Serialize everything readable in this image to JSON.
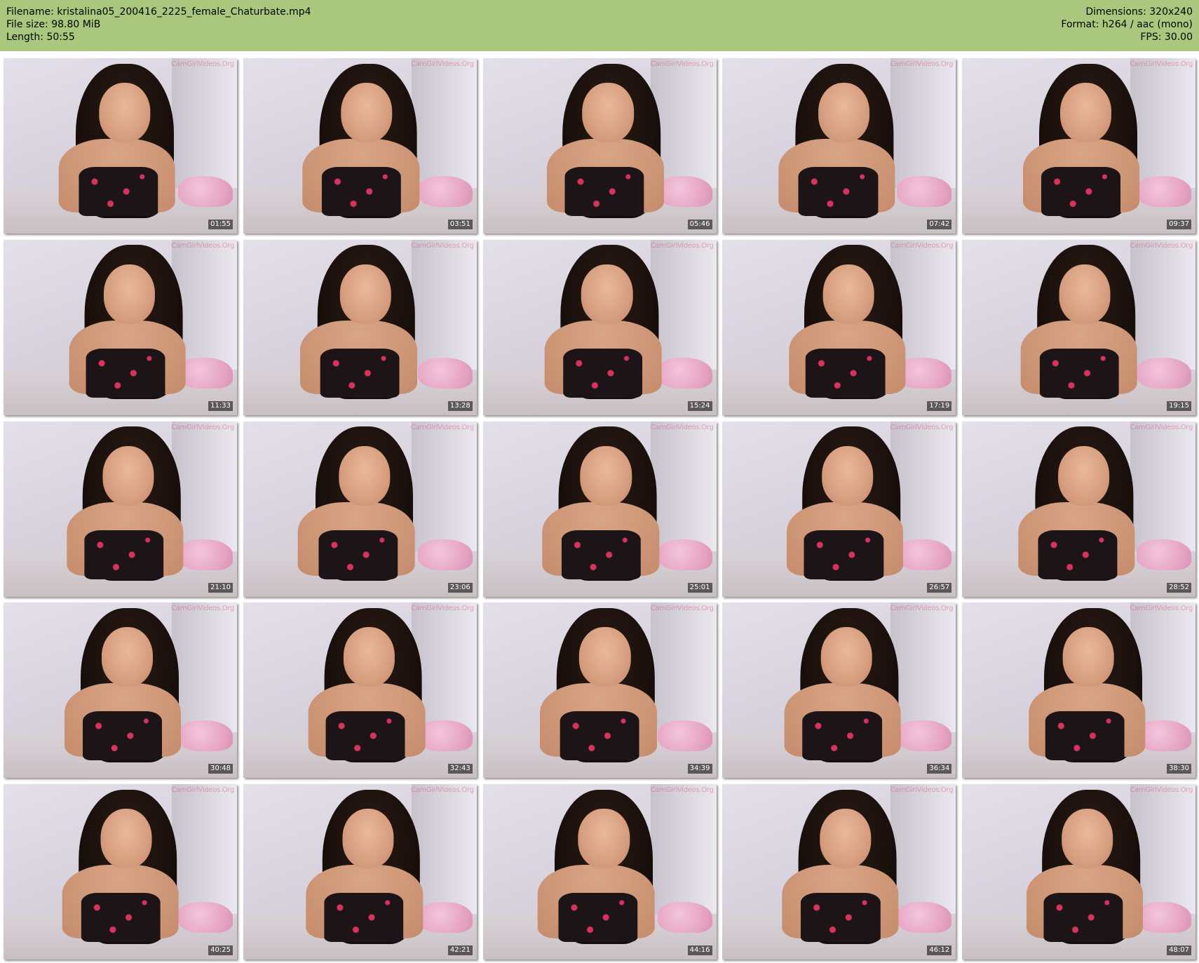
{
  "header": {
    "left": [
      "Filename: kristalina05_200416_2225_female_Chaturbate.mp4",
      "File size: 98.80 MiB",
      "Length: 50:55"
    ],
    "right": [
      "Dimensions: 320x240",
      "Format: h264 / aac (mono)",
      "FPS: 30.00"
    ],
    "background_color": "#a9c87d"
  },
  "thumbnails": [
    {
      "timestamp": "01:55"
    },
    {
      "timestamp": "03:51"
    },
    {
      "timestamp": "05:46"
    },
    {
      "timestamp": "07:42"
    },
    {
      "timestamp": "09:37"
    },
    {
      "timestamp": "11:33"
    },
    {
      "timestamp": "13:28"
    },
    {
      "timestamp": "15:24"
    },
    {
      "timestamp": "17:19"
    },
    {
      "timestamp": "19:15"
    },
    {
      "timestamp": "21:10"
    },
    {
      "timestamp": "23:06"
    },
    {
      "timestamp": "25:01"
    },
    {
      "timestamp": "26:57"
    },
    {
      "timestamp": "28:52"
    },
    {
      "timestamp": "30:48"
    },
    {
      "timestamp": "32:43"
    },
    {
      "timestamp": "34:39"
    },
    {
      "timestamp": "36:34"
    },
    {
      "timestamp": "38:30"
    },
    {
      "timestamp": "40:25"
    },
    {
      "timestamp": "42:21"
    },
    {
      "timestamp": "44:16"
    },
    {
      "timestamp": "46:12"
    },
    {
      "timestamp": "48:07"
    }
  ],
  "watermark_text": "CamGirlVideos.Org"
}
